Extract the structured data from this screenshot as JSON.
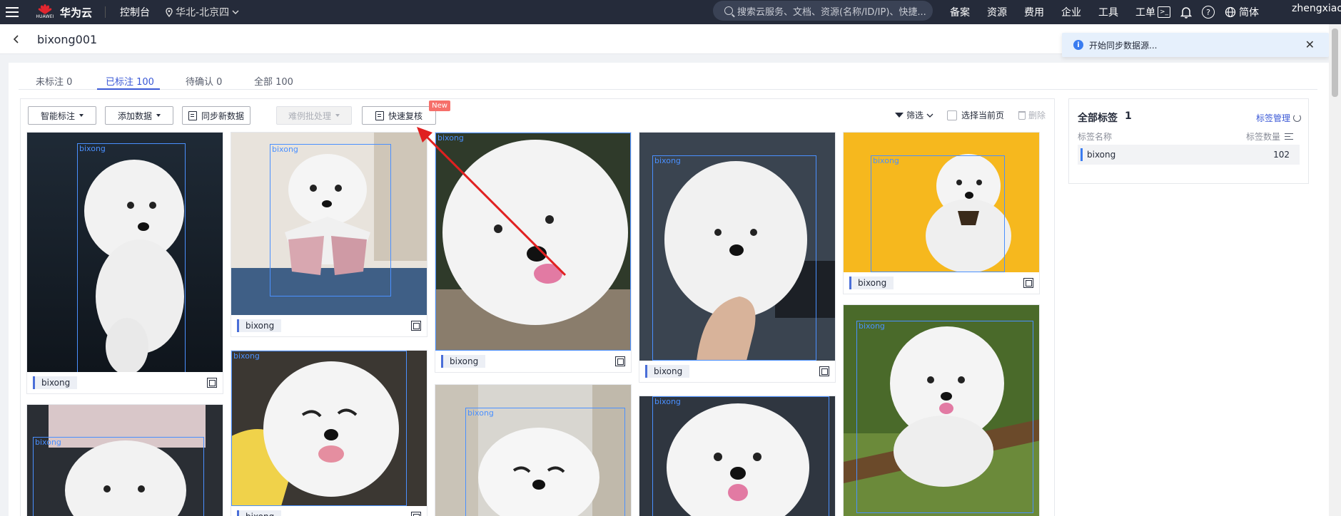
{
  "topbar": {
    "brand": "华为云",
    "brand_sub": "HUAWEI",
    "console": "控制台",
    "region": "华北-北京四",
    "search_placeholder": "搜索云服务、文档、资源(名称/ID/IP)、快捷...",
    "links": [
      "备案",
      "资源",
      "费用",
      "企业",
      "工具",
      "工单"
    ],
    "language": "简体",
    "username": "zhengxiaoji"
  },
  "breadcrumb": {
    "title": "bixong001"
  },
  "toast": {
    "message": "开始同步数据源..."
  },
  "tabs": [
    {
      "label": "未标注 0"
    },
    {
      "label": "已标注 100"
    },
    {
      "label": "待确认 0"
    },
    {
      "label": "全部 100"
    }
  ],
  "toolbar": {
    "smart_label": "智能标注",
    "add_data": "添加数据",
    "sync_data": "同步新数据",
    "hard_case": "难例批处理",
    "quick_review": "快速复核",
    "new_badge": "New",
    "filter": "筛选",
    "select_page": "选择当前页",
    "delete": "删除"
  },
  "cards": {
    "tag": "bixong",
    "bbox_label": "bixong"
  },
  "side": {
    "title": "全部标签",
    "count": "1",
    "manage": "标签管理",
    "col_name": "标签名称",
    "col_count": "标签数量",
    "rows": [
      {
        "name": "bixong",
        "count": "102"
      }
    ]
  },
  "colors": {
    "topbar": "#252b3a",
    "accent": "#3a58d6",
    "bbox": "#4a90ff",
    "badge": "#f66f6a",
    "annotation_arrow": "#e02020"
  }
}
